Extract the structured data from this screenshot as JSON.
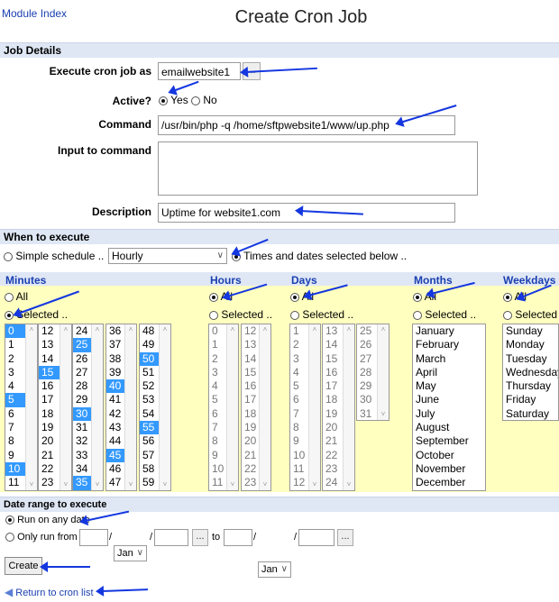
{
  "header": {
    "module_index": "Module Index",
    "title": "Create Cron Job"
  },
  "job_details": {
    "heading": "Job Details",
    "execute_as_label": "Execute cron job as",
    "execute_as_value": "emailwebsite1",
    "user_picker": "...",
    "active_label": "Active?",
    "active_yes": "Yes",
    "active_no": "No",
    "command_label": "Command",
    "command_value": "/usr/bin/php -q /home/sftpwebsite1/www/up.php",
    "input_label": "Input to command",
    "input_value": "",
    "description_label": "Description",
    "description_value": "Uptime for website1.com"
  },
  "when": {
    "heading": "When to execute",
    "simple_label": "Simple schedule ..",
    "simple_value": "Hourly",
    "times_label": "Times and dates selected below .."
  },
  "columns": {
    "minutes": "Minutes",
    "hours": "Hours",
    "days": "Days",
    "months": "Months",
    "weekdays": "Weekdays",
    "all": "All",
    "selected": "Selected .."
  },
  "minutes_lists": [
    [
      "0",
      "1",
      "2",
      "3",
      "4",
      "5",
      "6",
      "7",
      "8",
      "9",
      "10",
      "11"
    ],
    [
      "12",
      "13",
      "14",
      "15",
      "16",
      "17",
      "18",
      "19",
      "20",
      "21",
      "22",
      "23"
    ],
    [
      "24",
      "25",
      "26",
      "27",
      "28",
      "29",
      "30",
      "31",
      "32",
      "33",
      "34",
      "35"
    ],
    [
      "36",
      "37",
      "38",
      "39",
      "40",
      "41",
      "42",
      "43",
      "44",
      "45",
      "46",
      "47"
    ],
    [
      "48",
      "49",
      "50",
      "51",
      "52",
      "53",
      "54",
      "55",
      "56",
      "57",
      "58",
      "59"
    ]
  ],
  "hours_lists": [
    [
      "0",
      "1",
      "2",
      "3",
      "4",
      "5",
      "6",
      "7",
      "8",
      "9",
      "10",
      "11"
    ],
    [
      "12",
      "13",
      "14",
      "15",
      "16",
      "17",
      "18",
      "19",
      "20",
      "21",
      "22",
      "23"
    ]
  ],
  "days_lists": [
    [
      "1",
      "2",
      "3",
      "4",
      "5",
      "6",
      "7",
      "8",
      "9",
      "10",
      "11",
      "12"
    ],
    [
      "13",
      "14",
      "15",
      "16",
      "17",
      "18",
      "19",
      "20",
      "21",
      "22",
      "23",
      "24"
    ],
    [
      "25",
      "26",
      "27",
      "28",
      "29",
      "30",
      "31"
    ]
  ],
  "months_list": [
    "January",
    "February",
    "March",
    "April",
    "May",
    "June",
    "July",
    "August",
    "September",
    "October",
    "November",
    "December"
  ],
  "weekdays_list": [
    "Sunday",
    "Monday",
    "Tuesday",
    "Wednesday",
    "Thursday",
    "Friday",
    "Saturday"
  ],
  "date_range": {
    "heading": "Date range to execute",
    "any_date": "Run on any date",
    "only_from": "Only run from",
    "month_from": "Jan",
    "to": "to",
    "month_to": "Jan",
    "picker": "..."
  },
  "actions": {
    "create": "Create",
    "return": "Return to cron list"
  },
  "colors": {
    "selected": "#3399ff",
    "section": "#dfe7f5",
    "yellow": "#ffffc0",
    "arrow": "#1437e0",
    "link": "#1a3fb0"
  }
}
